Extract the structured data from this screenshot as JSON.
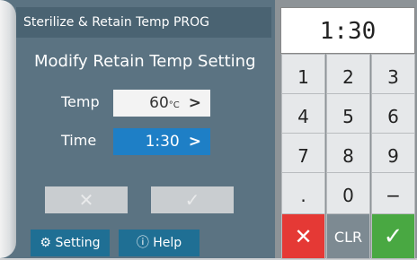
{
  "title": "Sterilize & Retain Temp PROG",
  "heading": "Modify Retain Temp Setting",
  "temp": {
    "label": "Temp",
    "value": "60",
    "unit": "°C",
    "chevron": ">"
  },
  "time": {
    "label": "Time",
    "value": "1:30",
    "chevron": ">"
  },
  "left_buttons": {
    "cancel": "✕",
    "confirm": "✓"
  },
  "bottom": {
    "setting_label": "Setting",
    "help_label": "Help"
  },
  "keypad": {
    "display": "1:30",
    "keys": [
      "1",
      "2",
      "3",
      "4",
      "5",
      "6",
      "7",
      "8",
      "9",
      ".",
      "0",
      "−"
    ],
    "cancel": "✕",
    "clear": "CLR",
    "ok": "✓"
  },
  "icons": {
    "setting": "gear-icon",
    "help": "question-icon"
  }
}
